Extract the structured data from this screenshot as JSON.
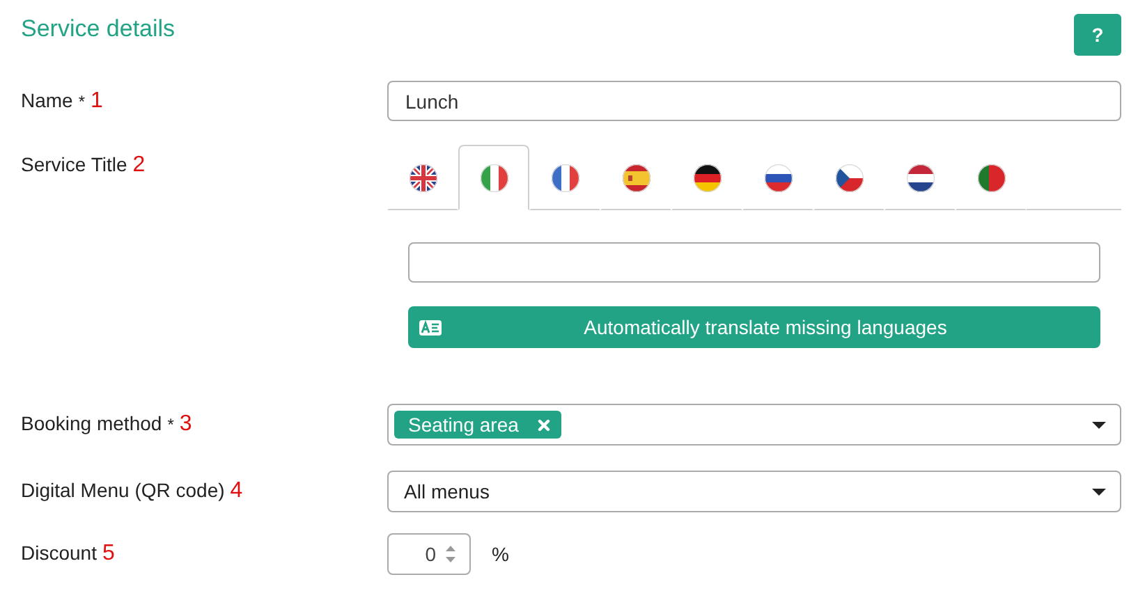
{
  "header": {
    "title": "Service details",
    "help_button": "?"
  },
  "fields": [
    {
      "kind": "text",
      "label": "Name",
      "required_mark": "*",
      "marker": "1",
      "value": "Lunch"
    },
    {
      "kind": "translations",
      "label": "Service Title",
      "marker": "2",
      "tabs": [
        {
          "kind": "uk",
          "selected": false
        },
        {
          "kind": "it",
          "selected": true
        },
        {
          "kind": "fr",
          "selected": false
        },
        {
          "kind": "es",
          "selected": false
        },
        {
          "kind": "de",
          "selected": false
        },
        {
          "kind": "ru",
          "selected": false
        },
        {
          "kind": "cz",
          "selected": false
        },
        {
          "kind": "nl",
          "selected": false
        },
        {
          "kind": "pt",
          "selected": false
        }
      ],
      "translate_button": "Automatically translate missing languages"
    },
    {
      "kind": "multiselect",
      "label": "Booking method",
      "required_mark": "*",
      "marker": "3",
      "tags": [
        "Seating area"
      ]
    },
    {
      "kind": "select",
      "label": "Digital Menu (QR code)",
      "marker": "4",
      "value": "All menus"
    },
    {
      "kind": "number",
      "label": "Discount",
      "marker": "5",
      "value": "0",
      "unit": "%"
    }
  ]
}
